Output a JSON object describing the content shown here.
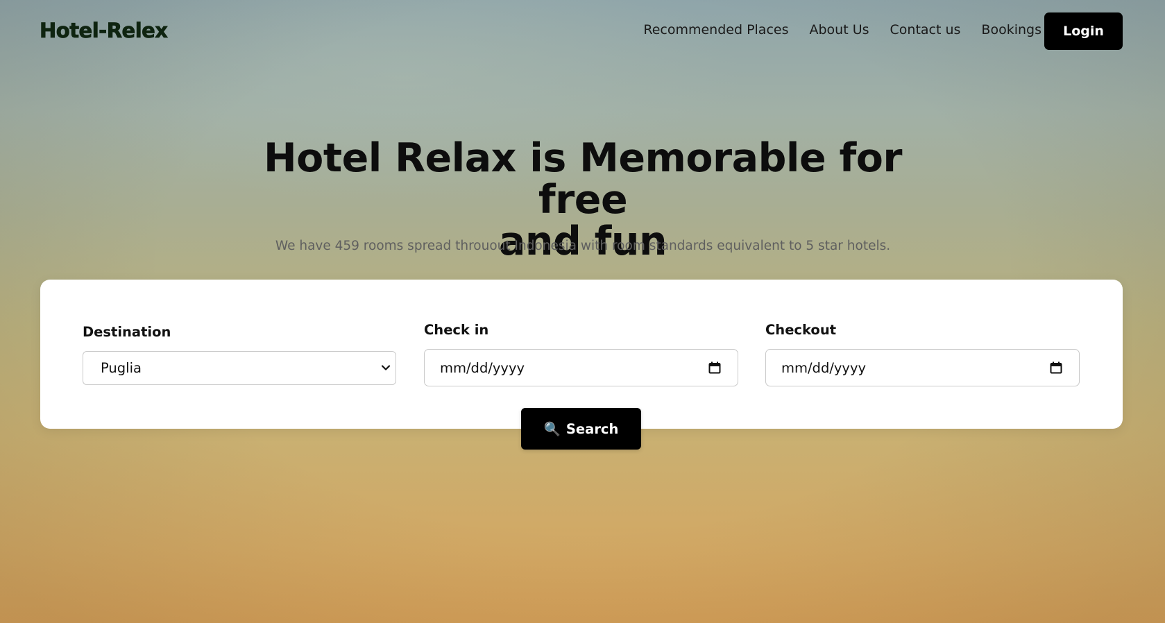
{
  "brand": {
    "logo": "Hotel-Relex"
  },
  "nav": {
    "links": [
      "Recommended Places",
      "About Us",
      "Contact us",
      "Bookings"
    ],
    "login_label": "Login"
  },
  "hero": {
    "title_line1": "Hotel Relax is Memorable for free",
    "title_line2": "and fun",
    "subtitle": "We have 459 rooms spread throuout Indonesia with room standards equivalent to 5 star hotels."
  },
  "search_form": {
    "destination": {
      "label": "Destination",
      "selected": "Puglia"
    },
    "check_in": {
      "label": "Check in",
      "placeholder": "mm/dd/yyyy"
    },
    "checkout": {
      "label": "Checkout",
      "placeholder": "mm/dd/yyyy"
    },
    "search_button": {
      "icon": "magnifier-icon",
      "emoji": "🔍",
      "label": "Search"
    }
  },
  "colors": {
    "accent": "#000000",
    "logo": "#0f2410",
    "background_top": "#8fa5aa",
    "background_bottom": "#d49f58"
  }
}
